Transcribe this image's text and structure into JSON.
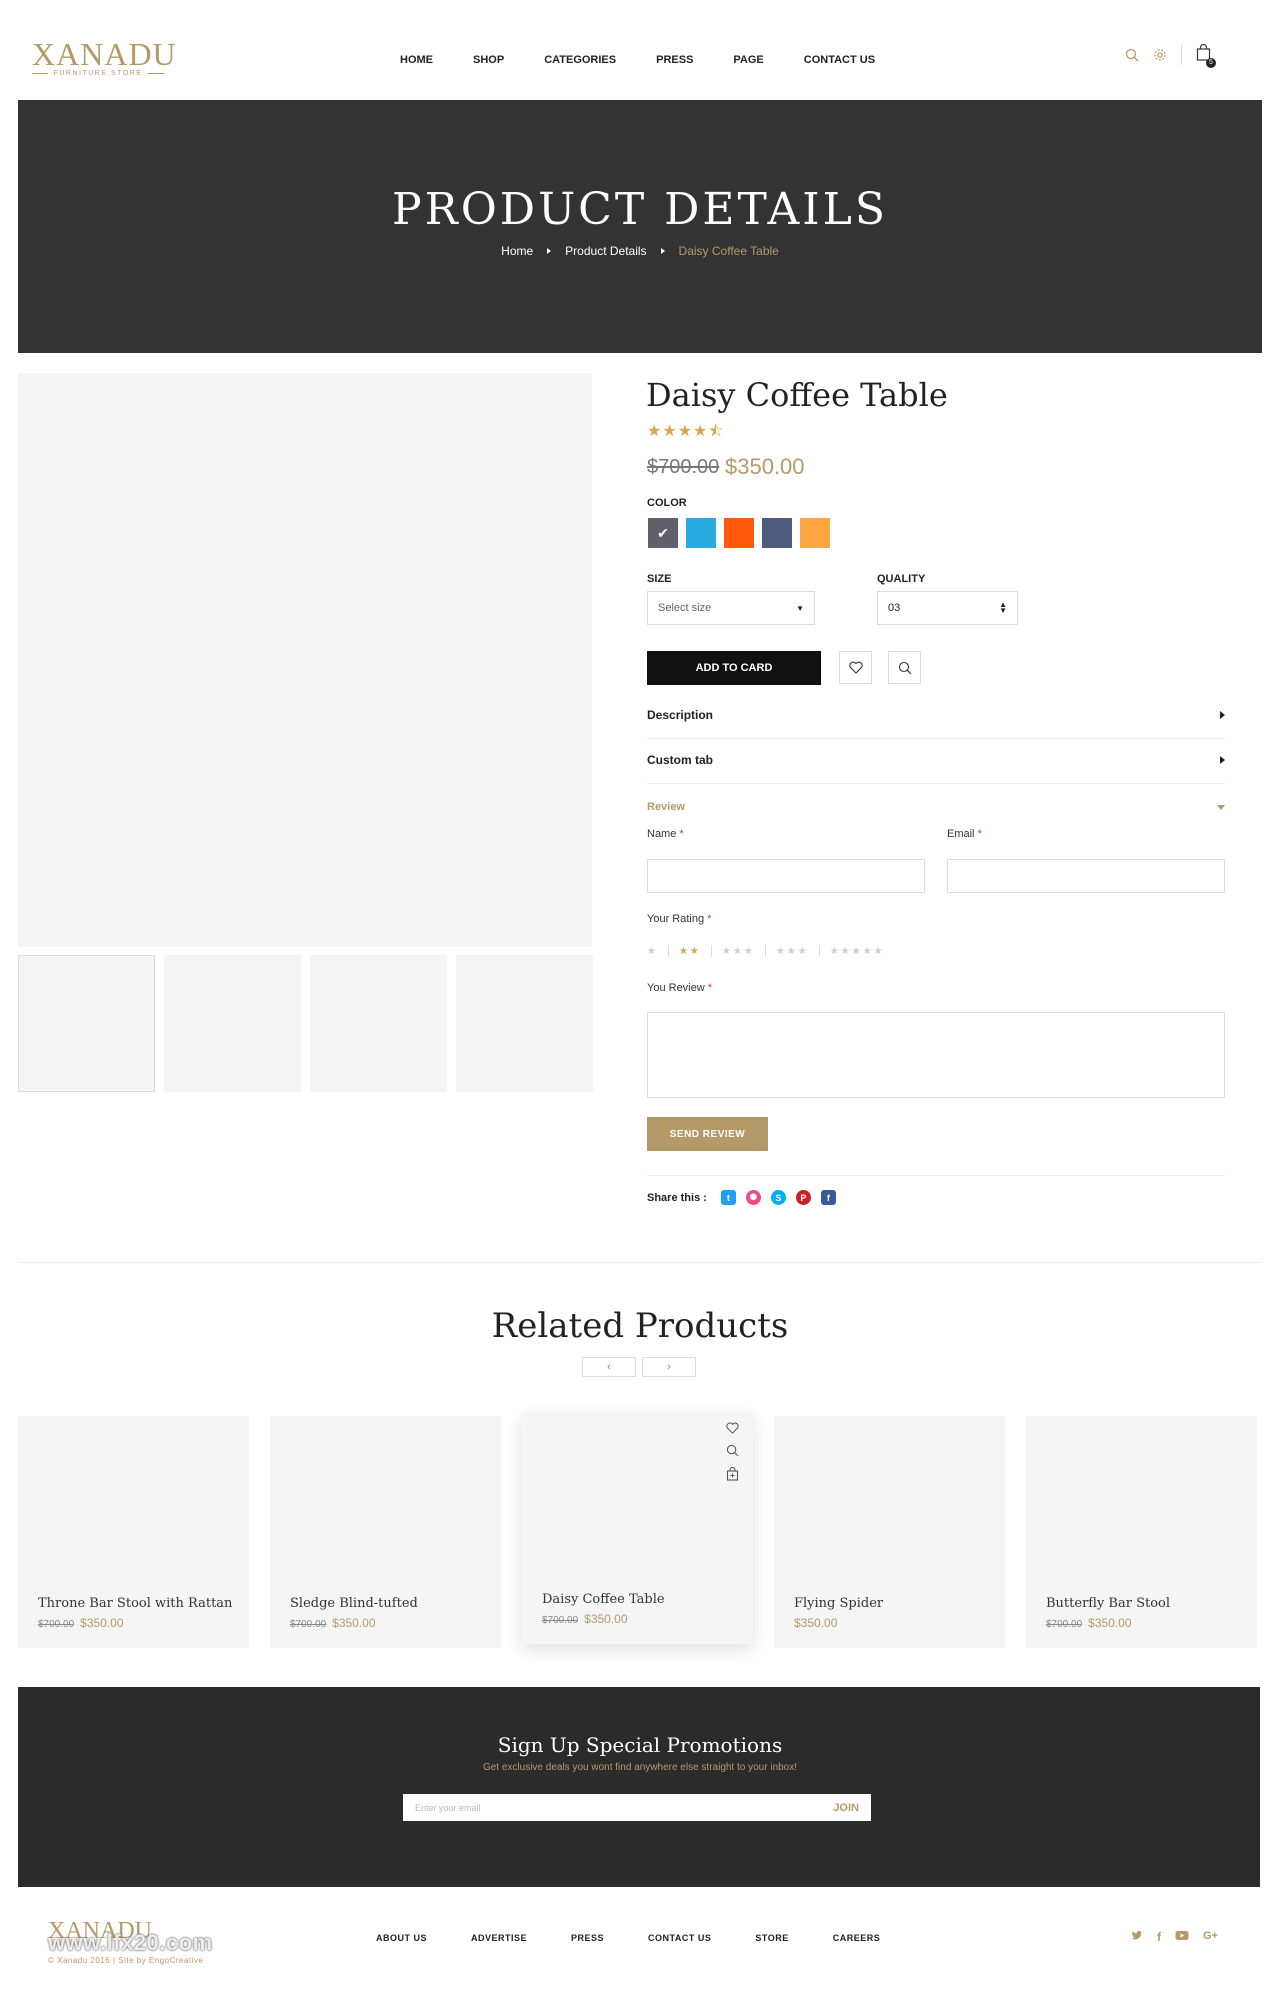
{
  "header": {
    "logo": "XANADU",
    "logo_tagline": "FURNITURE STORE",
    "nav": [
      "HOME",
      "SHOP",
      "CATEGORIES",
      "PRESS",
      "PAGE",
      "CONTACT US"
    ],
    "cart_count": "5"
  },
  "hero": {
    "title": "PRODUCT DETAILS",
    "breadcrumb": [
      "Home",
      "Product Details",
      "Daisy Coffee Table"
    ]
  },
  "product": {
    "title": "Daisy Coffee Table",
    "rating_stars": "★★★★⯪",
    "old_price": "$700.00",
    "new_price": "$350.00",
    "color_label": "COLOR",
    "colors": [
      "#5f6069",
      "#29abe2",
      "#ff5a0a",
      "#4e5a7e",
      "#ffa640"
    ],
    "size_label": "SIZE",
    "size_value": "Select size",
    "quality_label": "QUALITY",
    "quality_value": "03",
    "add_to_cart": "ADD TO CARD"
  },
  "tabs": {
    "description": "Description",
    "custom": "Custom tab",
    "review": "Review"
  },
  "review_form": {
    "name_label": "Name",
    "email_label": "Email",
    "rating_label": "Your Rating",
    "review_label": "You Review",
    "required_mark": "*",
    "rating_groups": [
      "★",
      "★★",
      "★★★",
      "★★★",
      "★★★★★"
    ],
    "send": "SEND REVIEW"
  },
  "share": {
    "label": "Share this :",
    "networks": [
      {
        "name": "twitter",
        "glyph": "t",
        "color": "#1da1f2"
      },
      {
        "name": "dribbble",
        "glyph": "✺",
        "color": "#ea4c89"
      },
      {
        "name": "skype",
        "glyph": "S",
        "color": "#00aff0"
      },
      {
        "name": "pinterest",
        "glyph": "P",
        "color": "#cb2027"
      },
      {
        "name": "facebook",
        "glyph": "f",
        "color": "#3b5998"
      }
    ]
  },
  "related": {
    "title": "Related Products",
    "prev": "‹",
    "next": "›",
    "items": [
      {
        "name": "Throne Bar Stool with Rattan",
        "old": "$700.00",
        "new": "$350.00"
      },
      {
        "name": "Sledge Blind-tufted",
        "old": "$700.00",
        "new": "$350.00"
      },
      {
        "name": "Daisy Coffee Table",
        "old": "$700.00",
        "new": "$350.00"
      },
      {
        "name": "Flying Spider",
        "old": "",
        "new": "$350.00"
      },
      {
        "name": "Butterfly Bar Stool",
        "old": "$700.00",
        "new": "$350.00"
      }
    ]
  },
  "promo": {
    "title": "Sign Up Special Promotions",
    "subtitle": "Get exclusive deals you wont find anywhere else straight to your inbox!",
    "placeholder": "Enter your email",
    "join": "JOIN"
  },
  "footer": {
    "logo": "XANADU",
    "watermark": "www.lfx20.com",
    "copyright": "© Xanadu 2016 | Site by EngoCreative",
    "nav": [
      "ABOUT US",
      "ADVERTISE",
      "PRESS",
      "CONTACT US",
      "STORE",
      "CAREERS"
    ],
    "social": [
      "twitter",
      "facebook",
      "youtube",
      "google-plus"
    ]
  }
}
